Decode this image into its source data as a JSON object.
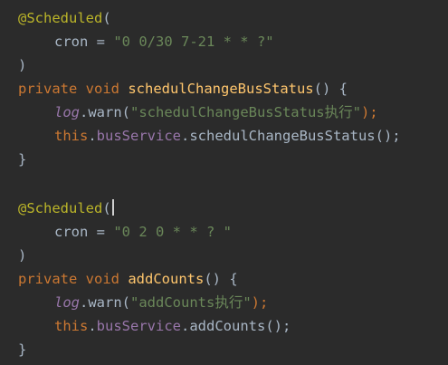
{
  "colors": {
    "background": "#2b2b2b",
    "annotation": "#bbb529",
    "keyword": "#cc7832",
    "method": "#ffc66d",
    "string": "#6a8759",
    "field": "#9876aa",
    "plain": "#a9b7c6"
  },
  "blocks": [
    {
      "annotation": "@Scheduled",
      "open_paren": "(",
      "cron_key": "cron",
      "assign": " = ",
      "cron_value": "\"0 0/30 7-21 * * ?\"",
      "close_paren": ")",
      "modifier": "private",
      "return_type": "void",
      "method_name": "schedulChangeBusStatus",
      "method_sig_tail": "() {",
      "log_var": "log",
      "log_call": ".warn(",
      "log_message": "\"schedulChangeBusStatus执行\"",
      "log_end": ");",
      "this_kw": "this",
      "dot": ".",
      "service_field": "busService",
      "service_call": ".schedulChangeBusStatus();",
      "close_brace": "}"
    },
    {
      "annotation": "@Scheduled",
      "open_paren": "(",
      "cron_key": "cron",
      "assign": " = ",
      "cron_value": "\"0 2 0 * * ? \"",
      "close_paren": ")",
      "modifier": "private",
      "return_type": "void",
      "method_name": "addCounts",
      "method_sig_tail": "() {",
      "log_var": "log",
      "log_call": ".warn(",
      "log_message": "\"addCounts执行\"",
      "log_end": ");",
      "this_kw": "this",
      "dot": ".",
      "service_field": "busService",
      "service_call": ".addCounts();",
      "close_brace": "}"
    }
  ]
}
